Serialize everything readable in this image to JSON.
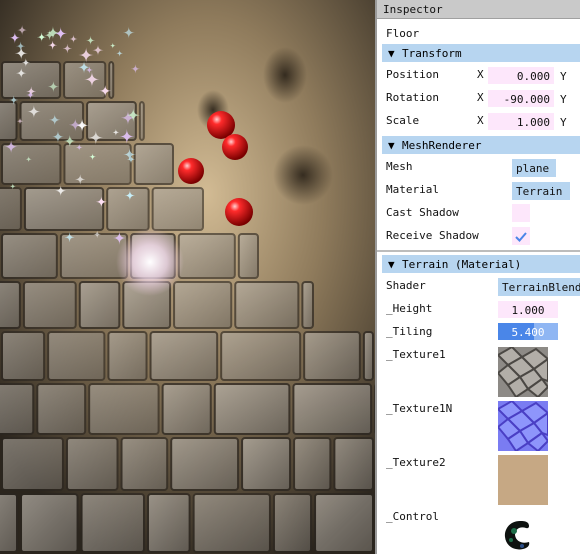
{
  "inspector": {
    "title": "Inspector",
    "object_name": "Floor",
    "transform": {
      "header": "Transform",
      "position": {
        "label": "Position",
        "x_axis": "X",
        "x": "0.000",
        "y_axis": "Y"
      },
      "rotation": {
        "label": "Rotation",
        "x_axis": "X",
        "x": "-90.000",
        "y_axis": "Y"
      },
      "scale": {
        "label": "Scale",
        "x_axis": "X",
        "x": "1.000",
        "y_axis": "Y"
      }
    },
    "mesh_renderer": {
      "header": "MeshRenderer",
      "mesh_label": "Mesh",
      "mesh_value": "plane",
      "material_label": "Material",
      "material_value": "Terrain",
      "cast_shadow_label": "Cast Shadow",
      "cast_shadow": false,
      "receive_shadow_label": "Receive Shadow",
      "receive_shadow": true
    },
    "material": {
      "header": "Terrain (Material)",
      "shader_label": "Shader",
      "shader_value": "TerrainBlend",
      "height_label": "_Height",
      "height_value": "1.000",
      "tiling_label": "_Tiling",
      "tiling_value": "5.400",
      "tiling_fill": 0.6,
      "texture1_label": "_Texture1",
      "texture1n_label": "_Texture1N",
      "texture2_label": "_Texture2",
      "control_label": "_Control"
    }
  },
  "colors": {
    "header_bg": "#b7d5f0",
    "field_bg": "#fde7fb",
    "accent": "#4a86e8"
  }
}
